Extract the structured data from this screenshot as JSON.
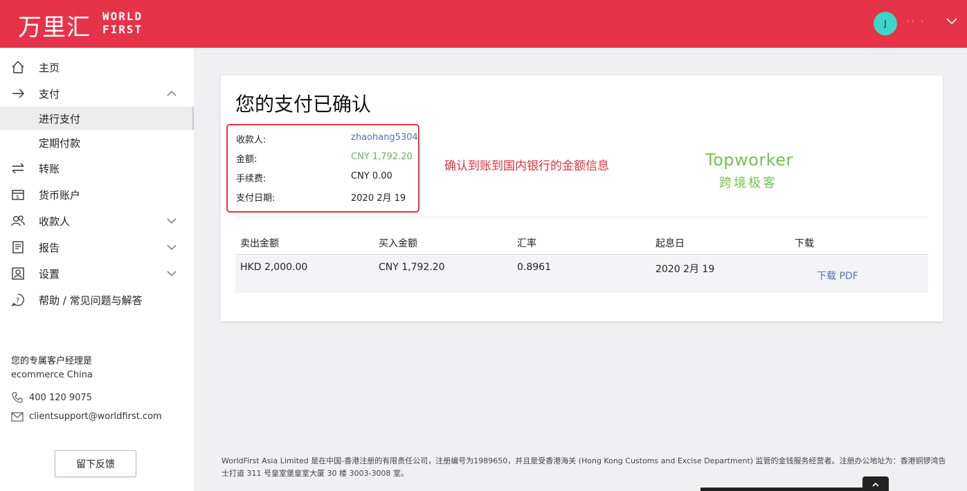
{
  "header": {
    "logo_cn": "万里汇",
    "logo_en_line1": "WORLD",
    "logo_en_line2": "FIRST",
    "avatar_initial": "J",
    "user_name": "·· ·",
    "brand_color": "#e63349"
  },
  "sidebar": {
    "items": [
      {
        "label": "主页",
        "icon": "home-icon"
      },
      {
        "label": "支付",
        "icon": "arrow-right-icon",
        "expanded": true
      },
      {
        "label": "进行支付",
        "active": true
      },
      {
        "label": "定期付款"
      },
      {
        "label": "转账",
        "icon": "transfer-icon"
      },
      {
        "label": "货币账户",
        "icon": "wallet-icon"
      },
      {
        "label": "收款人",
        "icon": "recipients-icon"
      },
      {
        "label": "报告",
        "icon": "report-icon"
      },
      {
        "label": "设置",
        "icon": "settings-icon"
      },
      {
        "label": "帮助 / 常见问题与解答",
        "icon": "help-icon"
      }
    ],
    "manager_title": "您的专属客户经理是",
    "manager_name": "ecommerce China",
    "phone": "400 120 9075",
    "email": "clientsupport@worldfirst.com",
    "feedback_label": "留下反馈"
  },
  "main": {
    "title": "您的支付已确认",
    "summary": {
      "recipient_label": "收款人:",
      "recipient_value": "zhaohang5304",
      "amount_label": "金额:",
      "amount_value": "CNY 1,792.20",
      "fee_label": "手续费:",
      "fee_value": "CNY 0.00",
      "date_label": "支付日期:",
      "date_value": "2020 2月 19"
    },
    "annotation": "确认到账到国内银行的金额信息",
    "watermark_en": "Topworker",
    "watermark_cn": "跨境极客",
    "table": {
      "headers": [
        "卖出金额",
        "买入金额",
        "汇率",
        "起息日",
        "下载"
      ],
      "row": {
        "sell": "HKD 2,000.00",
        "buy": "CNY 1,792.20",
        "rate": "0.8961",
        "value_date": "2020 2月 19",
        "download": "下载 PDF"
      }
    }
  },
  "footer": {
    "text": "WorldFirst Asia Limited 是在中国-香港注册的有限责任公司，注册编号为1989650，并且是受香港海关 (Hong Kong Customs and Excise Department) 监管的金钱服务经营者。注册办公地址为：香港铜锣湾告士打道 311 号皇室堡皇室大厦 30 楼 3003-3008 室。"
  }
}
